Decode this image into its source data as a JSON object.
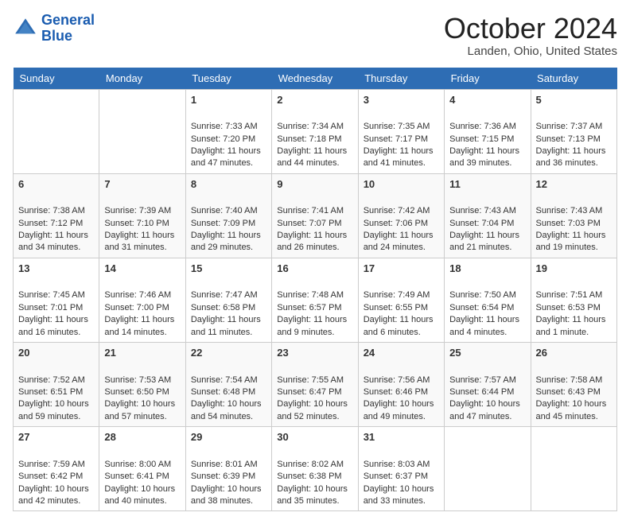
{
  "header": {
    "logo_line1": "General",
    "logo_line2": "Blue",
    "month": "October 2024",
    "location": "Landen, Ohio, United States"
  },
  "days_of_week": [
    "Sunday",
    "Monday",
    "Tuesday",
    "Wednesday",
    "Thursday",
    "Friday",
    "Saturday"
  ],
  "weeks": [
    [
      {
        "day": "",
        "empty": true
      },
      {
        "day": "",
        "empty": true
      },
      {
        "day": "1",
        "sunrise": "Sunrise: 7:33 AM",
        "sunset": "Sunset: 7:20 PM",
        "daylight": "Daylight: 11 hours and 47 minutes."
      },
      {
        "day": "2",
        "sunrise": "Sunrise: 7:34 AM",
        "sunset": "Sunset: 7:18 PM",
        "daylight": "Daylight: 11 hours and 44 minutes."
      },
      {
        "day": "3",
        "sunrise": "Sunrise: 7:35 AM",
        "sunset": "Sunset: 7:17 PM",
        "daylight": "Daylight: 11 hours and 41 minutes."
      },
      {
        "day": "4",
        "sunrise": "Sunrise: 7:36 AM",
        "sunset": "Sunset: 7:15 PM",
        "daylight": "Daylight: 11 hours and 39 minutes."
      },
      {
        "day": "5",
        "sunrise": "Sunrise: 7:37 AM",
        "sunset": "Sunset: 7:13 PM",
        "daylight": "Daylight: 11 hours and 36 minutes."
      }
    ],
    [
      {
        "day": "6",
        "sunrise": "Sunrise: 7:38 AM",
        "sunset": "Sunset: 7:12 PM",
        "daylight": "Daylight: 11 hours and 34 minutes."
      },
      {
        "day": "7",
        "sunrise": "Sunrise: 7:39 AM",
        "sunset": "Sunset: 7:10 PM",
        "daylight": "Daylight: 11 hours and 31 minutes."
      },
      {
        "day": "8",
        "sunrise": "Sunrise: 7:40 AM",
        "sunset": "Sunset: 7:09 PM",
        "daylight": "Daylight: 11 hours and 29 minutes."
      },
      {
        "day": "9",
        "sunrise": "Sunrise: 7:41 AM",
        "sunset": "Sunset: 7:07 PM",
        "daylight": "Daylight: 11 hours and 26 minutes."
      },
      {
        "day": "10",
        "sunrise": "Sunrise: 7:42 AM",
        "sunset": "Sunset: 7:06 PM",
        "daylight": "Daylight: 11 hours and 24 minutes."
      },
      {
        "day": "11",
        "sunrise": "Sunrise: 7:43 AM",
        "sunset": "Sunset: 7:04 PM",
        "daylight": "Daylight: 11 hours and 21 minutes."
      },
      {
        "day": "12",
        "sunrise": "Sunrise: 7:43 AM",
        "sunset": "Sunset: 7:03 PM",
        "daylight": "Daylight: 11 hours and 19 minutes."
      }
    ],
    [
      {
        "day": "13",
        "sunrise": "Sunrise: 7:45 AM",
        "sunset": "Sunset: 7:01 PM",
        "daylight": "Daylight: 11 hours and 16 minutes."
      },
      {
        "day": "14",
        "sunrise": "Sunrise: 7:46 AM",
        "sunset": "Sunset: 7:00 PM",
        "daylight": "Daylight: 11 hours and 14 minutes."
      },
      {
        "day": "15",
        "sunrise": "Sunrise: 7:47 AM",
        "sunset": "Sunset: 6:58 PM",
        "daylight": "Daylight: 11 hours and 11 minutes."
      },
      {
        "day": "16",
        "sunrise": "Sunrise: 7:48 AM",
        "sunset": "Sunset: 6:57 PM",
        "daylight": "Daylight: 11 hours and 9 minutes."
      },
      {
        "day": "17",
        "sunrise": "Sunrise: 7:49 AM",
        "sunset": "Sunset: 6:55 PM",
        "daylight": "Daylight: 11 hours and 6 minutes."
      },
      {
        "day": "18",
        "sunrise": "Sunrise: 7:50 AM",
        "sunset": "Sunset: 6:54 PM",
        "daylight": "Daylight: 11 hours and 4 minutes."
      },
      {
        "day": "19",
        "sunrise": "Sunrise: 7:51 AM",
        "sunset": "Sunset: 6:53 PM",
        "daylight": "Daylight: 11 hours and 1 minute."
      }
    ],
    [
      {
        "day": "20",
        "sunrise": "Sunrise: 7:52 AM",
        "sunset": "Sunset: 6:51 PM",
        "daylight": "Daylight: 10 hours and 59 minutes."
      },
      {
        "day": "21",
        "sunrise": "Sunrise: 7:53 AM",
        "sunset": "Sunset: 6:50 PM",
        "daylight": "Daylight: 10 hours and 57 minutes."
      },
      {
        "day": "22",
        "sunrise": "Sunrise: 7:54 AM",
        "sunset": "Sunset: 6:48 PM",
        "daylight": "Daylight: 10 hours and 54 minutes."
      },
      {
        "day": "23",
        "sunrise": "Sunrise: 7:55 AM",
        "sunset": "Sunset: 6:47 PM",
        "daylight": "Daylight: 10 hours and 52 minutes."
      },
      {
        "day": "24",
        "sunrise": "Sunrise: 7:56 AM",
        "sunset": "Sunset: 6:46 PM",
        "daylight": "Daylight: 10 hours and 49 minutes."
      },
      {
        "day": "25",
        "sunrise": "Sunrise: 7:57 AM",
        "sunset": "Sunset: 6:44 PM",
        "daylight": "Daylight: 10 hours and 47 minutes."
      },
      {
        "day": "26",
        "sunrise": "Sunrise: 7:58 AM",
        "sunset": "Sunset: 6:43 PM",
        "daylight": "Daylight: 10 hours and 45 minutes."
      }
    ],
    [
      {
        "day": "27",
        "sunrise": "Sunrise: 7:59 AM",
        "sunset": "Sunset: 6:42 PM",
        "daylight": "Daylight: 10 hours and 42 minutes."
      },
      {
        "day": "28",
        "sunrise": "Sunrise: 8:00 AM",
        "sunset": "Sunset: 6:41 PM",
        "daylight": "Daylight: 10 hours and 40 minutes."
      },
      {
        "day": "29",
        "sunrise": "Sunrise: 8:01 AM",
        "sunset": "Sunset: 6:39 PM",
        "daylight": "Daylight: 10 hours and 38 minutes."
      },
      {
        "day": "30",
        "sunrise": "Sunrise: 8:02 AM",
        "sunset": "Sunset: 6:38 PM",
        "daylight": "Daylight: 10 hours and 35 minutes."
      },
      {
        "day": "31",
        "sunrise": "Sunrise: 8:03 AM",
        "sunset": "Sunset: 6:37 PM",
        "daylight": "Daylight: 10 hours and 33 minutes."
      },
      {
        "day": "",
        "empty": true
      },
      {
        "day": "",
        "empty": true
      }
    ]
  ]
}
